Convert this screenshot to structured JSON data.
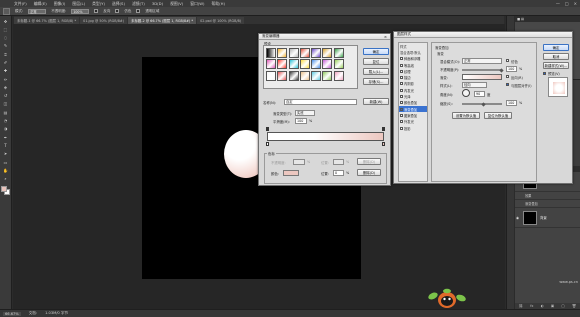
{
  "app": {
    "logo_text": "Ps"
  },
  "menubar": {
    "items": [
      "文件(F)",
      "编辑(E)",
      "图像(I)",
      "图层(L)",
      "类型(Y)",
      "选择(S)",
      "滤镜(T)",
      "3D(D)",
      "视图(V)",
      "窗口(W)",
      "帮助(H)"
    ],
    "window_controls": [
      "—",
      "□",
      "×"
    ]
  },
  "options_bar": {
    "mode_label": "模式:",
    "mode_value": "正常",
    "opacity_label": "不透明度:",
    "opacity_value": "100%",
    "reverse_label": "反向",
    "dither_label": "仿色",
    "transparency_label": "透明区域"
  },
  "tabs": [
    {
      "label": "未标题-1 @ 66.7% (图层 1, RGB/8) *",
      "active": false
    },
    {
      "label": "01.jpg @ 50% (RGB/8#)",
      "active": false
    },
    {
      "label": "未标题-2 @ 66.7% (图层 1, RGB/8#) *",
      "active": true
    },
    {
      "label": "02.psd @ 100% (RGB/8)",
      "active": false
    }
  ],
  "toolbar": {
    "tools": [
      "move",
      "marquee",
      "lasso",
      "quick-select",
      "crop",
      "eyedropper",
      "healing",
      "brush",
      "stamp",
      "history-brush",
      "eraser",
      "gradient",
      "blur",
      "dodge",
      "pen",
      "type",
      "path-select",
      "shape",
      "hand",
      "zoom"
    ],
    "tool_glyphs": [
      "✥",
      "⬚",
      "◌",
      "✎",
      "⌗",
      "✐",
      "✚",
      "✏",
      "⎈",
      "↺",
      "◫",
      "▤",
      "◔",
      "◑",
      "✒",
      "T",
      "➤",
      "▭",
      "✋",
      "⌕"
    ],
    "foreground_color": "#e8c2ba",
    "background_color": "#ffffff"
  },
  "gradient_editor": {
    "title": "渐变编辑器",
    "close": "×",
    "presets_label": "预设",
    "buttons": {
      "ok": "确定",
      "reset": "复位",
      "load": "载入(L)...",
      "save": "存储(S)...",
      "new": "新建(W)"
    },
    "name_label": "名称(N):",
    "name_value": "自定",
    "type_label": "渐变类型(T):",
    "type_value": "实底",
    "smooth_label": "平滑度(M):",
    "smooth_value": "100",
    "smooth_unit": "%",
    "stops_label": "色标",
    "opacity_label": "不透明度:",
    "opacity_unit": "%",
    "location_label": "位置:",
    "location_unit": "%",
    "delete_label": "删除(D)",
    "color_label": "颜色:",
    "color_location_value": "0",
    "stop_color": "#ecc7c0",
    "presets": [
      "#1a1a1a",
      "#f2b233",
      "#b8b8b8",
      "#e3523d",
      "#6a46c9",
      "#d8a22c",
      "#3aa04a",
      "#e05bb8",
      "#ff3b2f",
      "#29c0d7",
      "#ffdd44",
      "#4a8ee8",
      "#c55bd6",
      "#9ad05b",
      "#f7f7f7",
      "#e25454",
      "#3c3c3c",
      "#eac18b",
      "#5cc8e0",
      "#8ec95a",
      "#f0a7c2"
    ]
  },
  "layer_style": {
    "title": "图层样式",
    "list": [
      {
        "label": "样式",
        "kind": "head"
      },
      {
        "label": "混合选项:默认",
        "kind": "head"
      },
      {
        "label": "斜面和浮雕",
        "checked": false
      },
      {
        "label": "等高线",
        "checked": false
      },
      {
        "label": "纹理",
        "checked": false
      },
      {
        "label": "描边",
        "checked": false
      },
      {
        "label": "内阴影",
        "checked": false
      },
      {
        "label": "内发光",
        "checked": false
      },
      {
        "label": "光泽",
        "checked": false
      },
      {
        "label": "颜色叠加",
        "checked": false
      },
      {
        "label": "渐变叠加",
        "checked": true,
        "active": true
      },
      {
        "label": "图案叠加",
        "checked": false
      },
      {
        "label": "外发光",
        "checked": false
      },
      {
        "label": "投影",
        "checked": false
      }
    ],
    "section_title": "渐变叠加",
    "sub_title": "渐变",
    "blend_label": "混合模式(O):",
    "blend_value": "正常",
    "dither_label": "仿色",
    "opacity_label": "不透明度(P):",
    "opacity_value": "100",
    "unit_pct": "%",
    "gradient_label": "渐变:",
    "reverse_label": "反向(R)",
    "style_label": "样式(L):",
    "style_value": "径向",
    "align_label": "与图层对齐(I)",
    "angle_label": "角度(N):",
    "angle_value": "90",
    "angle_unit": "度",
    "scale_label": "缩放(S):",
    "scale_value": "100",
    "default_btn": "设置为默认值",
    "reset_btn": "复位为默认值",
    "buttons": {
      "ok": "确定",
      "cancel": "取消",
      "new_style": "新建样式(W)...",
      "preview": "预览(V)"
    }
  },
  "layers_panel": {
    "header_tabs": [
      "图层",
      "通道",
      "路径"
    ],
    "layers": [
      {
        "name": "图层 1",
        "visible": true,
        "fx": "fx"
      },
      {
        "name": "效果"
      },
      {
        "name": "渐变叠加"
      },
      {
        "name": "背景",
        "visible": true
      }
    ],
    "bottom_icons": [
      "⛓",
      "fx",
      "◐",
      "▣",
      "▢",
      "🗑"
    ]
  },
  "status": {
    "zoom": "66.67%",
    "doc_label": "文档:",
    "doc_size": "1.03M/0 字节"
  },
  "watermark": "www.ps.cn"
}
